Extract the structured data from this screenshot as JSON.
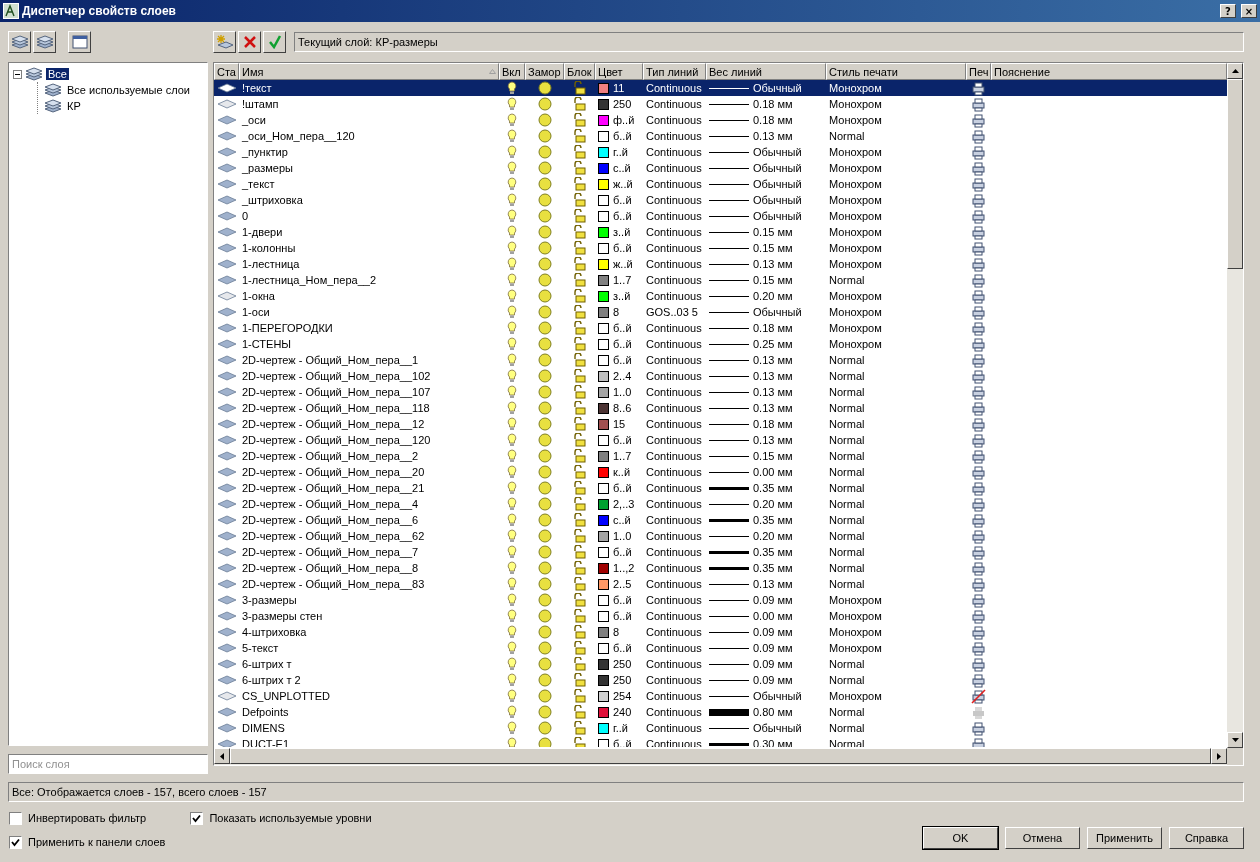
{
  "window": {
    "title": "Диспетчер свойств слоев",
    "buttons": [
      "?",
      "×"
    ]
  },
  "current_layer": "Текущий слой: КР-размеры",
  "tree": [
    {
      "label": "Все",
      "selected": true,
      "expanded": true,
      "children": [
        {
          "label": "Все используемые слои",
          "selected": false
        },
        {
          "label": "КР",
          "selected": false
        }
      ]
    }
  ],
  "search": {
    "placeholder": "Поиск слоя"
  },
  "table": {
    "columns": [
      "Ста",
      "Имя",
      "Вкл",
      "Замор",
      "Блок",
      "Цвет",
      "Тип линий",
      "Вес линий",
      "Стиль печати",
      "Печ",
      "Пояснение"
    ],
    "rows": [
      {
        "name": "!текст",
        "selected": true,
        "used": true,
        "on": true,
        "frozen": false,
        "locked": false,
        "color": "#f08080",
        "color_label": "11",
        "linetype": "Continuous",
        "kind": "thin",
        "lineweight": "Обычный",
        "plot_style": "Монохром",
        "plot": true,
        "plot_disabled": false
      },
      {
        "name": "!штамп",
        "selected": false,
        "used": false,
        "on": true,
        "frozen": false,
        "locked": false,
        "color": "#333333",
        "color_label": "250",
        "linetype": "Continuous",
        "kind": "thin",
        "lineweight": "0.18 мм",
        "plot_style": "Монохром",
        "plot": true,
        "plot_disabled": false
      },
      {
        "name": "_оси",
        "selected": false,
        "used": true,
        "on": true,
        "frozen": false,
        "locked": false,
        "color": "#ff00ff",
        "color_label": "ф..й",
        "linetype": "Continuous",
        "kind": "thin",
        "lineweight": "0.18 мм",
        "plot_style": "Монохром",
        "plot": true,
        "plot_disabled": false
      },
      {
        "name": "_оси_Ном_пера__120",
        "selected": false,
        "used": true,
        "on": true,
        "frozen": false,
        "locked": false,
        "color": "#ffffff",
        "color_label": "б..й",
        "linetype": "Continuous",
        "kind": "thin",
        "lineweight": "0.13 мм",
        "plot_style": "Normal",
        "plot": true,
        "plot_disabled": false
      },
      {
        "name": "_пунктир",
        "selected": false,
        "used": true,
        "on": true,
        "frozen": false,
        "locked": false,
        "color": "#00ffff",
        "color_label": "г..й",
        "linetype": "Continuous",
        "kind": "thin",
        "lineweight": "Обычный",
        "plot_style": "Монохром",
        "plot": true,
        "plot_disabled": false
      },
      {
        "name": "_размеры",
        "selected": false,
        "used": true,
        "on": true,
        "frozen": false,
        "locked": false,
        "color": "#0000ff",
        "color_label": "с..й",
        "linetype": "Continuous",
        "kind": "thin",
        "lineweight": "Обычный",
        "plot_style": "Монохром",
        "plot": true,
        "plot_disabled": false
      },
      {
        "name": "_текст",
        "selected": false,
        "used": true,
        "on": true,
        "frozen": false,
        "locked": false,
        "color": "#ffff00",
        "color_label": "ж..й",
        "linetype": "Continuous",
        "kind": "thin",
        "lineweight": "Обычный",
        "plot_style": "Монохром",
        "plot": true,
        "plot_disabled": false
      },
      {
        "name": "_штриховка",
        "selected": false,
        "used": true,
        "on": true,
        "frozen": false,
        "locked": false,
        "color": "#ffffff",
        "color_label": "б..й",
        "linetype": "Continuous",
        "kind": "thin",
        "lineweight": "Обычный",
        "plot_style": "Монохром",
        "plot": true,
        "plot_disabled": false
      },
      {
        "name": "0",
        "selected": false,
        "used": true,
        "on": true,
        "frozen": false,
        "locked": false,
        "color": "#ffffff",
        "color_label": "б..й",
        "linetype": "Continuous",
        "kind": "thin",
        "lineweight": "Обычный",
        "plot_style": "Монохром",
        "plot": true,
        "plot_disabled": false
      },
      {
        "name": "1-двери",
        "selected": false,
        "used": true,
        "on": true,
        "frozen": false,
        "locked": false,
        "color": "#00ff00",
        "color_label": "з..й",
        "linetype": "Continuous",
        "kind": "thin",
        "lineweight": "0.15 мм",
        "plot_style": "Монохром",
        "plot": true,
        "plot_disabled": false
      },
      {
        "name": "1-колонны",
        "selected": false,
        "used": true,
        "on": true,
        "frozen": false,
        "locked": false,
        "color": "#ffffff",
        "color_label": "б..й",
        "linetype": "Continuous",
        "kind": "thin",
        "lineweight": "0.15 мм",
        "plot_style": "Монохром",
        "plot": true,
        "plot_disabled": false
      },
      {
        "name": "1-лестница",
        "selected": false,
        "used": true,
        "on": true,
        "frozen": false,
        "locked": false,
        "color": "#ffff00",
        "color_label": "ж..й",
        "linetype": "Continuous",
        "kind": "thin",
        "lineweight": "0.13 мм",
        "plot_style": "Монохром",
        "plot": true,
        "plot_disabled": false
      },
      {
        "name": "1-лестница_Ном_пера__2",
        "selected": false,
        "used": true,
        "on": true,
        "frozen": false,
        "locked": false,
        "color": "#808080",
        "color_label": "1..7",
        "linetype": "Continuous",
        "kind": "thin",
        "lineweight": "0.15 мм",
        "plot_style": "Normal",
        "plot": true,
        "plot_disabled": false
      },
      {
        "name": "1-окна",
        "selected": false,
        "used": false,
        "on": true,
        "frozen": false,
        "locked": false,
        "color": "#00ff00",
        "color_label": "з..й",
        "linetype": "Continuous",
        "kind": "thin",
        "lineweight": "0.20 мм",
        "plot_style": "Монохром",
        "plot": true,
        "plot_disabled": false
      },
      {
        "name": "1-оси",
        "selected": false,
        "used": true,
        "on": true,
        "frozen": false,
        "locked": false,
        "color": "#808080",
        "color_label": "8",
        "linetype": "GOS..03 5",
        "kind": "thin",
        "lineweight": "Обычный",
        "plot_style": "Монохром",
        "plot": true,
        "plot_disabled": false
      },
      {
        "name": "1-ПЕРЕГОРОДКИ",
        "selected": false,
        "used": true,
        "on": true,
        "frozen": false,
        "locked": false,
        "color": "#ffffff",
        "color_label": "б..й",
        "linetype": "Continuous",
        "kind": "thin",
        "lineweight": "0.18 мм",
        "plot_style": "Монохром",
        "plot": true,
        "plot_disabled": false
      },
      {
        "name": "1-СТЕНЫ",
        "selected": false,
        "used": true,
        "on": true,
        "frozen": false,
        "locked": false,
        "color": "#ffffff",
        "color_label": "б..й",
        "linetype": "Continuous",
        "kind": "thin",
        "lineweight": "0.25 мм",
        "plot_style": "Монохром",
        "plot": true,
        "plot_disabled": false
      },
      {
        "name": "2D-чертеж - Общий_Ном_пера__1",
        "selected": false,
        "used": true,
        "on": true,
        "frozen": false,
        "locked": false,
        "color": "#ffffff",
        "color_label": "б..й",
        "linetype": "Continuous",
        "kind": "thin",
        "lineweight": "0.13 мм",
        "plot_style": "Normal",
        "plot": true,
        "plot_disabled": false
      },
      {
        "name": "2D-чертеж - Общий_Ном_пера__102",
        "selected": false,
        "used": true,
        "on": true,
        "frozen": false,
        "locked": false,
        "color": "#c0c0c0",
        "color_label": "2..4",
        "linetype": "Continuous",
        "kind": "thin",
        "lineweight": "0.13 мм",
        "plot_style": "Normal",
        "plot": true,
        "plot_disabled": false
      },
      {
        "name": "2D-чертеж - Общий_Ном_пера__107",
        "selected": false,
        "used": true,
        "on": true,
        "frozen": false,
        "locked": false,
        "color": "#a5a5a5",
        "color_label": "1..0",
        "linetype": "Continuous",
        "kind": "thin",
        "lineweight": "0.13 мм",
        "plot_style": "Normal",
        "plot": true,
        "plot_disabled": false
      },
      {
        "name": "2D-чертеж - Общий_Ном_пера__118",
        "selected": false,
        "used": true,
        "on": true,
        "frozen": false,
        "locked": false,
        "color": "#4c3333",
        "color_label": "8..6",
        "linetype": "Continuous",
        "kind": "thin",
        "lineweight": "0.13 мм",
        "plot_style": "Normal",
        "plot": true,
        "plot_disabled": false
      },
      {
        "name": "2D-чертеж - Общий_Ном_пера__12",
        "selected": false,
        "used": true,
        "on": true,
        "frozen": false,
        "locked": false,
        "color": "#a05050",
        "color_label": "15",
        "linetype": "Continuous",
        "kind": "thin",
        "lineweight": "0.18 мм",
        "plot_style": "Normal",
        "plot": true,
        "plot_disabled": false
      },
      {
        "name": "2D-чертеж - Общий_Ном_пера__120",
        "selected": false,
        "used": true,
        "on": true,
        "frozen": false,
        "locked": false,
        "color": "#ffffff",
        "color_label": "б..й",
        "linetype": "Continuous",
        "kind": "thin",
        "lineweight": "0.13 мм",
        "plot_style": "Normal",
        "plot": true,
        "plot_disabled": false
      },
      {
        "name": "2D-чертеж - Общий_Ном_пера__2",
        "selected": false,
        "used": true,
        "on": true,
        "frozen": false,
        "locked": false,
        "color": "#808080",
        "color_label": "1..7",
        "linetype": "Continuous",
        "kind": "thin",
        "lineweight": "0.15 мм",
        "plot_style": "Normal",
        "plot": true,
        "plot_disabled": false
      },
      {
        "name": "2D-чертеж - Общий_Ном_пера__20",
        "selected": false,
        "used": true,
        "on": true,
        "frozen": false,
        "locked": false,
        "color": "#ff0000",
        "color_label": "к..й",
        "linetype": "Continuous",
        "kind": "thin",
        "lineweight": "0.00 мм",
        "plot_style": "Normal",
        "plot": true,
        "plot_disabled": false
      },
      {
        "name": "2D-чертеж - Общий_Ном_пера__21",
        "selected": false,
        "used": true,
        "on": true,
        "frozen": false,
        "locked": false,
        "color": "#ffffff",
        "color_label": "б..й",
        "linetype": "Continuous",
        "kind": "bold",
        "lineweight": "0.35 мм",
        "plot_style": "Normal",
        "plot": true,
        "plot_disabled": false
      },
      {
        "name": "2D-чертеж - Общий_Ном_пера__4",
        "selected": false,
        "used": true,
        "on": true,
        "frozen": false,
        "locked": false,
        "color": "#00a030",
        "color_label": "2,..3",
        "linetype": "Continuous",
        "kind": "thin",
        "lineweight": "0.20 мм",
        "plot_style": "Normal",
        "plot": true,
        "plot_disabled": false
      },
      {
        "name": "2D-чертеж - Общий_Ном_пера__6",
        "selected": false,
        "used": true,
        "on": true,
        "frozen": false,
        "locked": false,
        "color": "#0000ff",
        "color_label": "с..й",
        "linetype": "Continuous",
        "kind": "bold",
        "lineweight": "0.35 мм",
        "plot_style": "Normal",
        "plot": true,
        "plot_disabled": false
      },
      {
        "name": "2D-чертеж - Общий_Ном_пера__62",
        "selected": false,
        "used": true,
        "on": true,
        "frozen": false,
        "locked": false,
        "color": "#a5a5a5",
        "color_label": "1..0",
        "linetype": "Continuous",
        "kind": "thin",
        "lineweight": "0.20 мм",
        "plot_style": "Normal",
        "plot": true,
        "plot_disabled": false
      },
      {
        "name": "2D-чертеж - Общий_Ном_пера__7",
        "selected": false,
        "used": true,
        "on": true,
        "frozen": false,
        "locked": false,
        "color": "#ffffff",
        "color_label": "б..й",
        "linetype": "Continuous",
        "kind": "bold",
        "lineweight": "0.35 мм",
        "plot_style": "Normal",
        "plot": true,
        "plot_disabled": false
      },
      {
        "name": "2D-чертеж - Общий_Ном_пера__8",
        "selected": false,
        "used": true,
        "on": true,
        "frozen": false,
        "locked": false,
        "color": "#a00000",
        "color_label": "1..,2",
        "linetype": "Continuous",
        "kind": "bold",
        "lineweight": "0.35 мм",
        "plot_style": "Normal",
        "plot": true,
        "plot_disabled": false
      },
      {
        "name": "2D-чертеж - Общий_Ном_пера__83",
        "selected": false,
        "used": true,
        "on": true,
        "frozen": false,
        "locked": false,
        "color": "#ff9966",
        "color_label": "2..5",
        "linetype": "Continuous",
        "kind": "thin",
        "lineweight": "0.13 мм",
        "plot_style": "Normal",
        "plot": true,
        "plot_disabled": false
      },
      {
        "name": "3-размеры",
        "selected": false,
        "used": true,
        "on": true,
        "frozen": false,
        "locked": false,
        "color": "#ffffff",
        "color_label": "б..й",
        "linetype": "Continuous",
        "kind": "thin",
        "lineweight": "0.09 мм",
        "plot_style": "Монохром",
        "plot": true,
        "plot_disabled": false
      },
      {
        "name": "3-размеры стен",
        "selected": false,
        "used": true,
        "on": true,
        "frozen": false,
        "locked": false,
        "color": "#ffffff",
        "color_label": "б..й",
        "linetype": "Continuous",
        "kind": "thin",
        "lineweight": "0.00 мм",
        "plot_style": "Монохром",
        "plot": true,
        "plot_disabled": false
      },
      {
        "name": "4-штриховка",
        "selected": false,
        "used": true,
        "on": true,
        "frozen": false,
        "locked": false,
        "color": "#808080",
        "color_label": "8",
        "linetype": "Continuous",
        "kind": "thin",
        "lineweight": "0.09 мм",
        "plot_style": "Монохром",
        "plot": true,
        "plot_disabled": false
      },
      {
        "name": "5-текст",
        "selected": false,
        "used": true,
        "on": true,
        "frozen": false,
        "locked": false,
        "color": "#ffffff",
        "color_label": "б..й",
        "linetype": "Continuous",
        "kind": "thin",
        "lineweight": "0.09 мм",
        "plot_style": "Монохром",
        "plot": true,
        "plot_disabled": false
      },
      {
        "name": "6-штрих т",
        "selected": false,
        "used": true,
        "on": true,
        "frozen": false,
        "locked": false,
        "color": "#333333",
        "color_label": "250",
        "linetype": "Continuous",
        "kind": "thin",
        "lineweight": "0.09 мм",
        "plot_style": "Normal",
        "plot": true,
        "plot_disabled": false
      },
      {
        "name": "6-штрих т 2",
        "selected": false,
        "used": true,
        "on": true,
        "frozen": false,
        "locked": false,
        "color": "#333333",
        "color_label": "250",
        "linetype": "Continuous",
        "kind": "thin",
        "lineweight": "0.09 мм",
        "plot_style": "Normal",
        "plot": true,
        "plot_disabled": false
      },
      {
        "name": "CS_UNPLOTTED",
        "selected": false,
        "used": false,
        "on": true,
        "frozen": false,
        "locked": false,
        "color": "#d0d0d0",
        "color_label": "254",
        "linetype": "Continuous",
        "kind": "thin",
        "lineweight": "Обычный",
        "plot_style": "Монохром",
        "plot": false,
        "plot_disabled": false
      },
      {
        "name": "Defpoints",
        "selected": false,
        "used": true,
        "on": true,
        "frozen": false,
        "locked": false,
        "color": "#e0103a",
        "color_label": "240",
        "linetype": "Continuous",
        "kind": "heavy",
        "lineweight": "0.80 мм",
        "plot_style": "Normal",
        "plot": true,
        "plot_disabled": true
      },
      {
        "name": "DIMENS",
        "selected": false,
        "used": true,
        "on": true,
        "frozen": false,
        "locked": false,
        "color": "#00ffff",
        "color_label": "г..й",
        "linetype": "Continuous",
        "kind": "thin",
        "lineweight": "Обычный",
        "plot_style": "Normal",
        "plot": true,
        "plot_disabled": false
      },
      {
        "name": "DUCT-E1",
        "selected": false,
        "used": true,
        "on": true,
        "frozen": false,
        "locked": false,
        "color": "#ffffff",
        "color_label": "б..й",
        "linetype": "Continuous",
        "kind": "bold",
        "lineweight": "0.30 мм",
        "plot_style": "Normal",
        "plot": true,
        "plot_disabled": false
      }
    ]
  },
  "status_bar": "Все: Отображается слоев - 157, всего слоев - 157",
  "options": [
    {
      "label": "Инвертировать фильтр",
      "checked": false
    },
    {
      "label": "Показать используемые уровни",
      "checked": true
    },
    {
      "label": "Применить к панели слоев",
      "checked": true
    }
  ],
  "buttons": [
    {
      "label": "OK",
      "default": true
    },
    {
      "label": "Отмена",
      "default": false
    },
    {
      "label": "Применить",
      "default": false
    },
    {
      "label": "Справка",
      "default": false
    }
  ]
}
